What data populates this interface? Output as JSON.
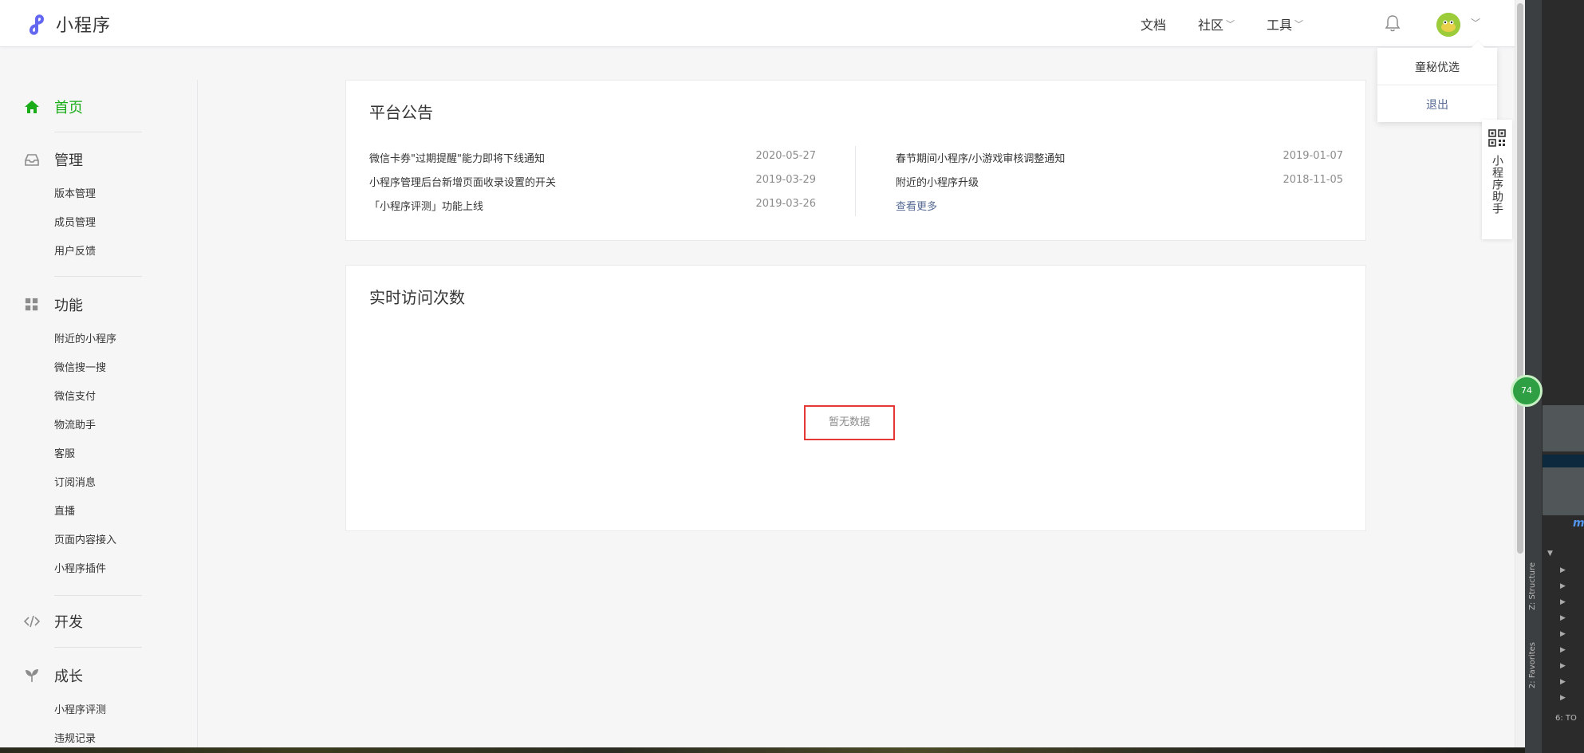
{
  "header": {
    "logo_text": "小程序",
    "nav": [
      {
        "label": "文档",
        "has_dropdown": false
      },
      {
        "label": "社区",
        "has_dropdown": true
      },
      {
        "label": "工具",
        "has_dropdown": true
      }
    ],
    "icons": [
      "logo-icon",
      "bell-icon",
      "avatar",
      "chevron-down-icon"
    ]
  },
  "account_menu": {
    "name": "童秘优选",
    "logout": "退出"
  },
  "assistant": {
    "label": "小程序助手",
    "icon": "qrcode-icon"
  },
  "sidebar": {
    "groups": [
      {
        "title": "首页",
        "icon": "home-icon",
        "active": true,
        "items": []
      },
      {
        "title": "管理",
        "icon": "inbox-icon",
        "active": false,
        "items": [
          "版本管理",
          "成员管理",
          "用户反馈"
        ]
      },
      {
        "title": "功能",
        "icon": "grid-icon",
        "active": false,
        "items": [
          "附近的小程序",
          "微信搜一搜",
          "微信支付",
          "物流助手",
          "客服",
          "订阅消息",
          "直播",
          "页面内容接入",
          "小程序插件"
        ]
      },
      {
        "title": "开发",
        "icon": "code-icon",
        "active": false,
        "items": []
      },
      {
        "title": "成长",
        "icon": "sprout-icon",
        "active": false,
        "items": [
          "小程序评测",
          "违规记录"
        ]
      }
    ]
  },
  "announcements": {
    "title": "平台公告",
    "left": [
      {
        "text": "微信卡券\"过期提醒\"能力即将下线通知",
        "date": "2020-05-27"
      },
      {
        "text": "小程序管理后台新增页面收录设置的开关",
        "date": "2019-03-29"
      },
      {
        "text": "「小程序评测」功能上线",
        "date": "2019-03-26"
      }
    ],
    "right": [
      {
        "text": "春节期间小程序/小游戏审核调整通知",
        "date": "2019-01-07"
      },
      {
        "text": "附近的小程序升级",
        "date": "2018-11-05"
      }
    ],
    "more": "查看更多"
  },
  "realtime": {
    "title": "实时访问次数",
    "empty_text": "暂无数据"
  },
  "ide_sidebar": {
    "labels": [
      "Z: Structure",
      "2: Favorites",
      "6: TO"
    ],
    "badge": "74"
  },
  "colors": {
    "accent_green": "#1aad19",
    "link_blue": "#576b95",
    "highlight_red": "#e43937"
  }
}
